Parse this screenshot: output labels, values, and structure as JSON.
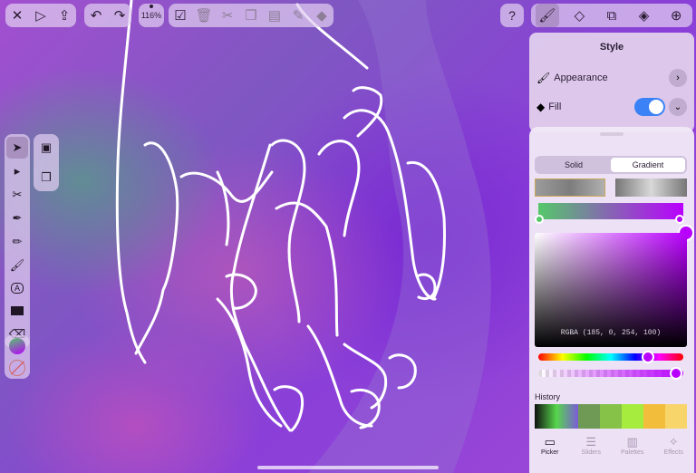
{
  "toolbar": {
    "zoom_label": "116%",
    "left_group": [
      "close-icon",
      "play-icon",
      "share-icon"
    ],
    "history_group": [
      "undo-icon",
      "redo-icon"
    ],
    "edit_group": [
      "select-all-icon",
      "trash-icon",
      "cut-icon",
      "copy-icon",
      "paste-icon",
      "color-sampler-icon",
      "fill-bucket-icon"
    ]
  },
  "right_toolbar": {
    "help_label": "?",
    "tabs": [
      "style-brush-icon",
      "transform-icon",
      "arrange-icon",
      "layers-icon",
      "add-icon"
    ]
  },
  "tools": [
    "selection-arrow-icon",
    "direct-select-icon",
    "scissors-path-icon",
    "pen-icon",
    "pencil-icon",
    "brush-icon",
    "text-icon",
    "rectangle-icon",
    "eraser-icon"
  ],
  "style_panel": {
    "title": "Style",
    "appearance_label": "Appearance",
    "fill_label": "Fill",
    "fill_enabled": true,
    "accent": "#3a82f6"
  },
  "color_picker": {
    "tabs": [
      "Solid",
      "Gradient"
    ],
    "active_tab": "Gradient",
    "gradient_stops": [
      "#55c86a",
      "#b900fe"
    ],
    "rgba_readout": "RGBA (185, 0, 254, 100)",
    "selected_color": "#b900fe",
    "history_label": "History",
    "history_swatches": [
      "#56d64b",
      "#7d5bd8",
      "#6f9a55",
      "#86c248",
      "#a6ec3f",
      "#f1bd3a",
      "#f7d56a",
      "#f3e59a",
      "#e2f08a"
    ],
    "nav": [
      {
        "label": "Picker",
        "icon": "monitor-icon"
      },
      {
        "label": "Sliders",
        "icon": "sliders-icon"
      },
      {
        "label": "Palettes",
        "icon": "palettes-icon"
      },
      {
        "label": "Effects",
        "icon": "effects-icon"
      }
    ],
    "active_nav": "Picker"
  }
}
